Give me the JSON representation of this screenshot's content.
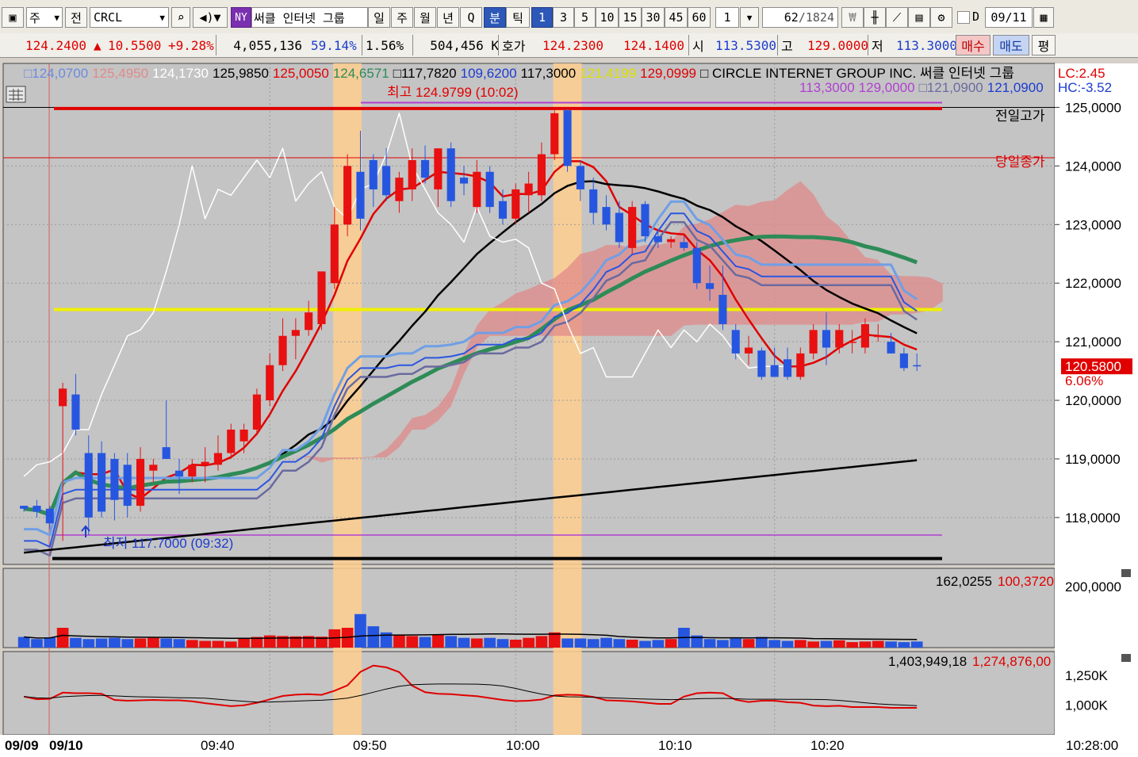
{
  "toolbar": {
    "market": "주",
    "all": "전",
    "symbol": "CRCL",
    "exchange_badge": "NY",
    "stock_name": "써클 인터넷 그룹",
    "periods": [
      "일",
      "주",
      "월",
      "년",
      "Q"
    ],
    "minute": "분",
    "tick": "틱",
    "intervals": [
      "1",
      "3",
      "5",
      "10",
      "15",
      "30",
      "45",
      "60"
    ],
    "multiplier": "1",
    "bar_count": "62",
    "bar_total": "/1824",
    "date_flag": "D",
    "date": "09/11"
  },
  "quote": {
    "last": "124.2400",
    "change_arrow": "▲",
    "change": "10.5500",
    "change_pct": "+9.28%",
    "volume": "4,055,136",
    "vol_ratio": "59.14%",
    "turnover": "1.56%",
    "amount": "504,456 K",
    "bid_label": "호가",
    "ask": "124.2300",
    "bid": "124.1400",
    "open_label": "시",
    "open": "113.5300",
    "high_label": "고",
    "high": "129.0000",
    "low_label": "저",
    "low": "113.3000",
    "buy_label": "매수",
    "sell_label": "매도",
    "flat_label": "평"
  },
  "indicator_values": [
    {
      "text": "□124,0700",
      "color": "#6c8ae0"
    },
    {
      "text": "125,4950",
      "color": "#e08a8a"
    },
    {
      "text": "124,1730",
      "color": "#ffffff"
    },
    {
      "text": "125,9850",
      "color": "#000000"
    },
    {
      "text": "125,0050",
      "color": "#e00000"
    },
    {
      "text": "124,6571",
      "color": "#2e8b57"
    },
    {
      "text": "□117,7820",
      "color": "#000000"
    },
    {
      "text": "109,6200",
      "color": "#1c3cd0"
    },
    {
      "text": "117,3000",
      "color": "#000000"
    },
    {
      "text": "121,4199",
      "color": "#e0e000"
    },
    {
      "text": "129,0999",
      "color": "#e00000"
    },
    {
      "text": "□ CIRCLE INTERNET GROUP INC.  써클 인터넷 그룹",
      "color": "#000000"
    }
  ],
  "indicator_values_2": [
    {
      "text": "113,3000",
      "color": "#b040d0"
    },
    {
      "text": "129,0000",
      "color": "#b040d0"
    },
    {
      "text": "□121,0900",
      "color": "#6a6aa0"
    },
    {
      "text": "121,0900",
      "color": "#1c3cd0"
    }
  ],
  "lc_label": "LC:2.45",
  "hc_label": "HC:-3.52",
  "annotations": {
    "high_marker": "최고 124.9799 (10:02)",
    "low_marker": "최저 117.7000 (09:32)",
    "prev_high": "전일고가",
    "today_close": "당일종가",
    "last_price_tag": "120.5800",
    "last_pct_tag": "6.06%"
  },
  "volume_header": {
    "value1": "162,0255",
    "value2": "100,3720",
    "value2_color": "#e00000"
  },
  "amount_header": {
    "value1": "1,403,949,18",
    "value2": "1,274,876,00",
    "value2_color": "#e00000"
  },
  "colors": {
    "up": "#e81010",
    "down": "#2656e0",
    "bg": "#c4c4c4",
    "grid": "#9a9a9a"
  },
  "chart_data": {
    "type": "candlestick",
    "price_axis": {
      "ticks": [
        125,
        124,
        123,
        122,
        121,
        120,
        119,
        118
      ],
      "tick_labels": [
        "125,0000",
        "124,0000",
        "123,0000",
        "122,0000",
        "121,0000",
        "120,0000",
        "119,0000",
        "118,0000"
      ],
      "ylim": [
        117.2,
        125.75
      ]
    },
    "volume_axis": {
      "ticks": [
        200000
      ],
      "tick_labels": [
        "200,0000"
      ],
      "ylim": [
        0,
        260000
      ]
    },
    "amount_axis": {
      "ticks": [
        1250000,
        1000000
      ],
      "tick_labels": [
        "1,250K",
        "1,000K"
      ],
      "ylim": [
        750000,
        1450000
      ]
    },
    "time_labels": [
      "09/09",
      "09/10",
      "09:40",
      "09:50",
      "10:00",
      "10:10",
      "10:20",
      "10:28:00"
    ],
    "reference_lines": {
      "prev_high": 125.0,
      "today_close": 124.14,
      "period_high": 124.98,
      "period_low": 117.7,
      "yellow_line": 121.55,
      "black_bottom": 117.3
    },
    "candles": [
      {
        "t": "09/09",
        "o": 118.2,
        "h": 118.2,
        "l": 118.1,
        "c": 118.15
      },
      {
        "t": "09:30",
        "o": 118.2,
        "h": 118.3,
        "l": 118.0,
        "c": 118.1
      },
      {
        "t": "09:30",
        "o": 118.15,
        "h": 118.2,
        "l": 117.8,
        "c": 117.9
      },
      {
        "t": "09:31",
        "o": 119.9,
        "h": 120.3,
        "l": 117.6,
        "c": 120.2
      },
      {
        "t": "09:31",
        "o": 120.1,
        "h": 120.45,
        "l": 119.4,
        "c": 119.5
      },
      {
        "t": "09:32",
        "o": 119.1,
        "h": 119.4,
        "l": 117.7,
        "c": 118.0
      },
      {
        "t": "09:32",
        "o": 119.1,
        "h": 119.3,
        "l": 118.0,
        "c": 118.1
      },
      {
        "t": "09:33",
        "o": 119.0,
        "h": 119.1,
        "l": 117.95,
        "c": 118.3
      },
      {
        "t": "09:33",
        "o": 118.9,
        "h": 119.1,
        "l": 118.0,
        "c": 118.2
      },
      {
        "t": "09:34",
        "o": 118.2,
        "h": 119.2,
        "l": 118.1,
        "c": 119.0
      },
      {
        "t": "09:34",
        "o": 118.8,
        "h": 119.0,
        "l": 118.6,
        "c": 118.9
      },
      {
        "t": "09:35",
        "o": 119.2,
        "h": 120.0,
        "l": 119.0,
        "c": 119.0
      },
      {
        "t": "09:35",
        "o": 118.8,
        "h": 119.0,
        "l": 118.4,
        "c": 118.7
      },
      {
        "t": "09:36",
        "o": 118.7,
        "h": 119.0,
        "l": 118.6,
        "c": 118.9
      },
      {
        "t": "09:36",
        "o": 118.9,
        "h": 119.2,
        "l": 118.6,
        "c": 118.95
      },
      {
        "t": "09:37",
        "o": 118.9,
        "h": 119.4,
        "l": 118.8,
        "c": 119.1
      },
      {
        "t": "09:37",
        "o": 119.1,
        "h": 119.6,
        "l": 119.0,
        "c": 119.5
      },
      {
        "t": "09:38",
        "o": 119.3,
        "h": 119.6,
        "l": 119.1,
        "c": 119.5
      },
      {
        "t": "09:38",
        "o": 119.5,
        "h": 120.2,
        "l": 119.4,
        "c": 120.1
      },
      {
        "t": "09:39",
        "o": 120.0,
        "h": 120.8,
        "l": 119.9,
        "c": 120.6
      },
      {
        "t": "09:39",
        "o": 120.6,
        "h": 121.4,
        "l": 120.5,
        "c": 121.1
      },
      {
        "t": "09:40",
        "o": 121.1,
        "h": 121.4,
        "l": 120.7,
        "c": 121.2
      },
      {
        "t": "09:40",
        "o": 121.2,
        "h": 121.7,
        "l": 121.1,
        "c": 121.5
      },
      {
        "t": "09:41",
        "o": 121.3,
        "h": 122.2,
        "l": 121.2,
        "c": 122.2
      },
      {
        "t": "09:41",
        "o": 122.0,
        "h": 123.3,
        "l": 121.9,
        "c": 123.0
      },
      {
        "t": "09:42",
        "o": 123.0,
        "h": 124.2,
        "l": 122.8,
        "c": 124.0
      },
      {
        "t": "09:42",
        "o": 123.9,
        "h": 124.6,
        "l": 122.9,
        "c": 123.1
      },
      {
        "t": "09:43",
        "o": 124.1,
        "h": 124.2,
        "l": 123.3,
        "c": 123.6
      },
      {
        "t": "09:43",
        "o": 124.0,
        "h": 124.3,
        "l": 123.4,
        "c": 123.5
      },
      {
        "t": "09:44",
        "o": 123.4,
        "h": 123.9,
        "l": 123.2,
        "c": 123.8
      },
      {
        "t": "09:44",
        "o": 123.6,
        "h": 124.3,
        "l": 123.4,
        "c": 124.1
      },
      {
        "t": "09:45",
        "o": 124.1,
        "h": 124.35,
        "l": 123.7,
        "c": 123.8
      },
      {
        "t": "09:45",
        "o": 123.6,
        "h": 124.3,
        "l": 123.3,
        "c": 124.3
      },
      {
        "t": "09:46",
        "o": 124.3,
        "h": 124.4,
        "l": 123.3,
        "c": 123.4
      },
      {
        "t": "09:46",
        "o": 123.8,
        "h": 124.0,
        "l": 123.5,
        "c": 123.7
      },
      {
        "t": "09:47",
        "o": 123.3,
        "h": 124.1,
        "l": 123.2,
        "c": 123.9
      },
      {
        "t": "09:47",
        "o": 123.9,
        "h": 124.0,
        "l": 123.2,
        "c": 123.3
      },
      {
        "t": "09:48",
        "o": 123.4,
        "h": 123.6,
        "l": 123.0,
        "c": 123.1
      },
      {
        "t": "09:48",
        "o": 123.1,
        "h": 123.7,
        "l": 123.0,
        "c": 123.6
      },
      {
        "t": "09:49",
        "o": 123.5,
        "h": 123.9,
        "l": 123.2,
        "c": 123.7
      },
      {
        "t": "09:49",
        "o": 123.5,
        "h": 124.4,
        "l": 123.4,
        "c": 124.2
      },
      {
        "t": "09:50",
        "o": 124.2,
        "h": 124.95,
        "l": 124.1,
        "c": 124.9
      },
      {
        "t": "09:50",
        "o": 124.95,
        "h": 124.98,
        "l": 123.9,
        "c": 124.0
      },
      {
        "t": "09:51",
        "o": 124.0,
        "h": 124.1,
        "l": 123.4,
        "c": 123.6
      },
      {
        "t": "09:51",
        "o": 123.6,
        "h": 123.8,
        "l": 123.0,
        "c": 123.2
      },
      {
        "t": "09:52",
        "o": 123.3,
        "h": 123.5,
        "l": 122.9,
        "c": 123.0
      },
      {
        "t": "09:52",
        "o": 123.2,
        "h": 123.4,
        "l": 122.6,
        "c": 122.7
      },
      {
        "t": "09:53",
        "o": 122.6,
        "h": 123.4,
        "l": 122.5,
        "c": 123.3
      },
      {
        "t": "09:53",
        "o": 123.35,
        "h": 123.4,
        "l": 122.7,
        "c": 122.8
      },
      {
        "t": "09:54",
        "o": 122.8,
        "h": 122.9,
        "l": 122.6,
        "c": 122.7
      },
      {
        "t": "09:54",
        "o": 122.7,
        "h": 122.8,
        "l": 122.6,
        "c": 122.75
      },
      {
        "t": "09:55",
        "o": 122.7,
        "h": 122.8,
        "l": 122.55,
        "c": 122.6
      },
      {
        "t": "09:55",
        "o": 122.6,
        "h": 122.7,
        "l": 121.9,
        "c": 122.0
      },
      {
        "t": "09:56",
        "o": 122.0,
        "h": 122.3,
        "l": 121.7,
        "c": 121.9
      },
      {
        "t": "09:56",
        "o": 121.8,
        "h": 122.3,
        "l": 121.2,
        "c": 121.3
      },
      {
        "t": "09:57",
        "o": 121.2,
        "h": 121.3,
        "l": 120.7,
        "c": 120.8
      },
      {
        "t": "09:57",
        "o": 120.8,
        "h": 121.1,
        "l": 120.6,
        "c": 120.9
      },
      {
        "t": "09:58",
        "o": 120.85,
        "h": 120.9,
        "l": 120.35,
        "c": 120.4
      },
      {
        "t": "09:58",
        "o": 120.6,
        "h": 120.9,
        "l": 120.4,
        "c": 120.4
      },
      {
        "t": "09:59",
        "o": 120.7,
        "h": 120.9,
        "l": 120.35,
        "c": 120.4
      },
      {
        "t": "09:59",
        "o": 120.4,
        "h": 120.9,
        "l": 120.35,
        "c": 120.8
      },
      {
        "t": "10:00",
        "o": 120.8,
        "h": 121.3,
        "l": 120.7,
        "c": 121.2
      },
      {
        "t": "10:00",
        "o": 121.2,
        "h": 121.5,
        "l": 120.6,
        "c": 120.9
      },
      {
        "t": "10:01",
        "o": 120.9,
        "h": 121.3,
        "l": 120.8,
        "c": 121.2
      },
      {
        "t": "10:01",
        "o": 121.0,
        "h": 121.2,
        "l": 120.8,
        "c": 121.0
      },
      {
        "t": "10:02",
        "o": 120.9,
        "h": 121.4,
        "l": 120.8,
        "c": 121.3
      },
      {
        "t": "10:02",
        "o": 121.1,
        "h": 121.3,
        "l": 121.0,
        "c": 121.1
      },
      {
        "t": "10:03",
        "o": 121.0,
        "h": 121.15,
        "l": 120.8,
        "c": 120.8
      },
      {
        "t": "10:03",
        "o": 120.8,
        "h": 120.9,
        "l": 120.5,
        "c": 120.55
      },
      {
        "t": "10:04",
        "o": 120.6,
        "h": 120.8,
        "l": 120.5,
        "c": 120.58
      }
    ],
    "volume": [
      35000,
      28000,
      33000,
      65000,
      32000,
      28000,
      30000,
      32000,
      28000,
      30000,
      32000,
      30000,
      28000,
      25000,
      22000,
      22000,
      20000,
      30000,
      35000,
      40000,
      38000,
      37000,
      38000,
      36000,
      60000,
      65000,
      110000,
      70000,
      50000,
      40000,
      38000,
      35000,
      42000,
      38000,
      32000,
      30000,
      32000,
      28000,
      26000,
      32000,
      38000,
      50000,
      30000,
      30000,
      28000,
      32000,
      28000,
      26000,
      22000,
      25000,
      28000,
      65000,
      40000,
      28000,
      25000,
      30000,
      28000,
      35000,
      25000,
      22000,
      25000,
      20000,
      22000,
      24000,
      18000,
      20000,
      22000,
      20000,
      18000,
      20000
    ]
  }
}
